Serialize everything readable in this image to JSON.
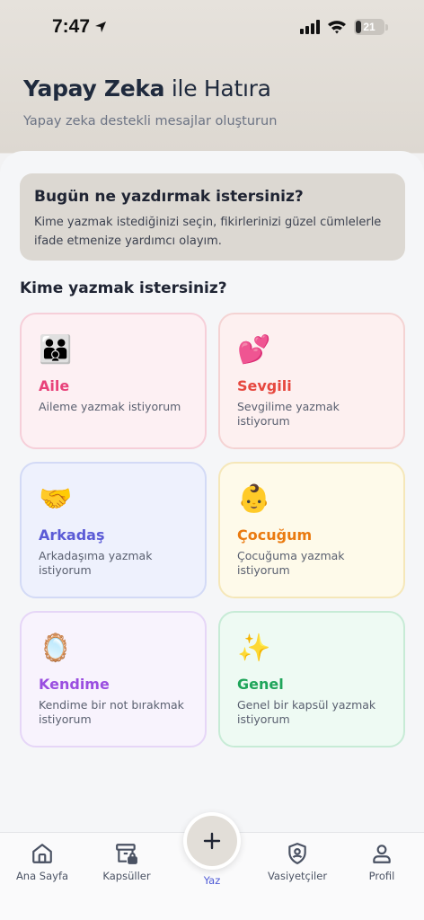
{
  "status_bar": {
    "time": "7:47",
    "battery": "21",
    "battery_level": 0.21
  },
  "header": {
    "title_bold": "Yapay Zeka",
    "title_rest": " ile Hatıra",
    "subtitle": "Yapay zeka destekli mesajlar oluşturun"
  },
  "intro": {
    "title": "Bugün ne yazdırmak istersiniz?",
    "text": "Kime yazmak istediğinizi seçin, fikirlerinizi güzel cümlelerle ifade etmenize yardımcı olayım."
  },
  "section_title": "Kime yazmak istersiniz?",
  "cards": [
    {
      "emoji": "👪",
      "title": "Aile",
      "desc": "Aileme yazmak istiyorum"
    },
    {
      "emoji": "💕",
      "title": "Sevgili",
      "desc": "Sevgilime yazmak istiyorum"
    },
    {
      "emoji": "🤝",
      "title": "Arkadaş",
      "desc": "Arkadaşıma yazmak istiyorum"
    },
    {
      "emoji": "👶",
      "title": "Çocuğum",
      "desc": "Çocuğuma yazmak istiyorum"
    },
    {
      "emoji": "🪞",
      "title": "Kendime",
      "desc": "Kendime bir not bırakmak istiyorum"
    },
    {
      "emoji": "✨",
      "title": "Genel",
      "desc": "Genel bir kapsül yazmak istiyorum"
    }
  ],
  "tabbar": {
    "home": "Ana Sayfa",
    "capsules": "Kapsüller",
    "write": "Yaz",
    "trustees": "Vasiyetçiler",
    "profile": "Profil"
  },
  "colors": {
    "accent": "#4f5bd5",
    "aile": "#e8427a",
    "sevgili": "#e6483f",
    "arkadas": "#5b5bd6",
    "cocugum": "#ea7a10",
    "kendime": "#9a4ee0",
    "genel": "#1fa55a"
  }
}
